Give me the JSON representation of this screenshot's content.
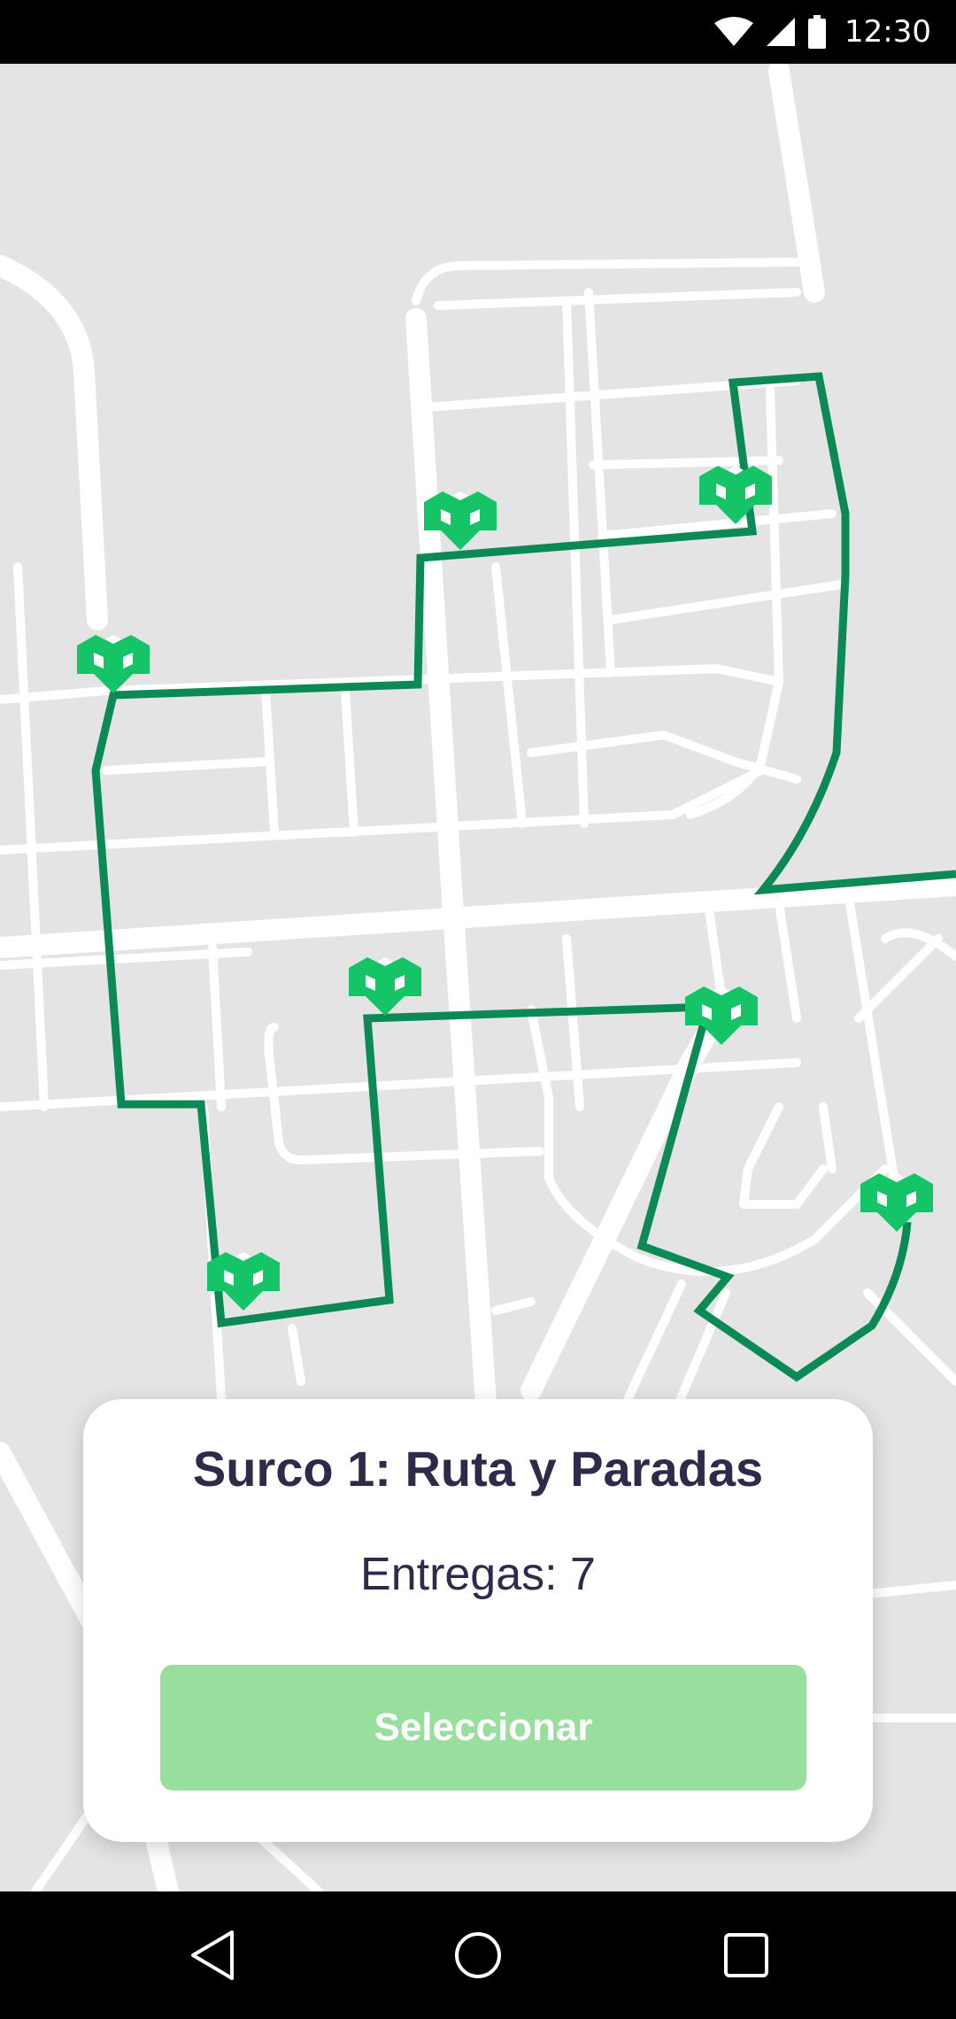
{
  "status_bar": {
    "time": "12:30",
    "icons": [
      "wifi-icon",
      "signal-icon",
      "battery-icon"
    ]
  },
  "map": {
    "route_color": "#0b8a55",
    "marker_color": "#15c466",
    "road_color": "#ffffff",
    "background_color": "#e4e4e4",
    "stop_count_shown": 7
  },
  "card": {
    "title": "Surco 1: Ruta y Paradas",
    "subtitle": "Entregas: 7",
    "button_label": "Seleccionar",
    "button_color": "#98df9e"
  },
  "nav_bar": {
    "buttons": [
      "back-icon",
      "home-icon",
      "recents-icon"
    ]
  }
}
